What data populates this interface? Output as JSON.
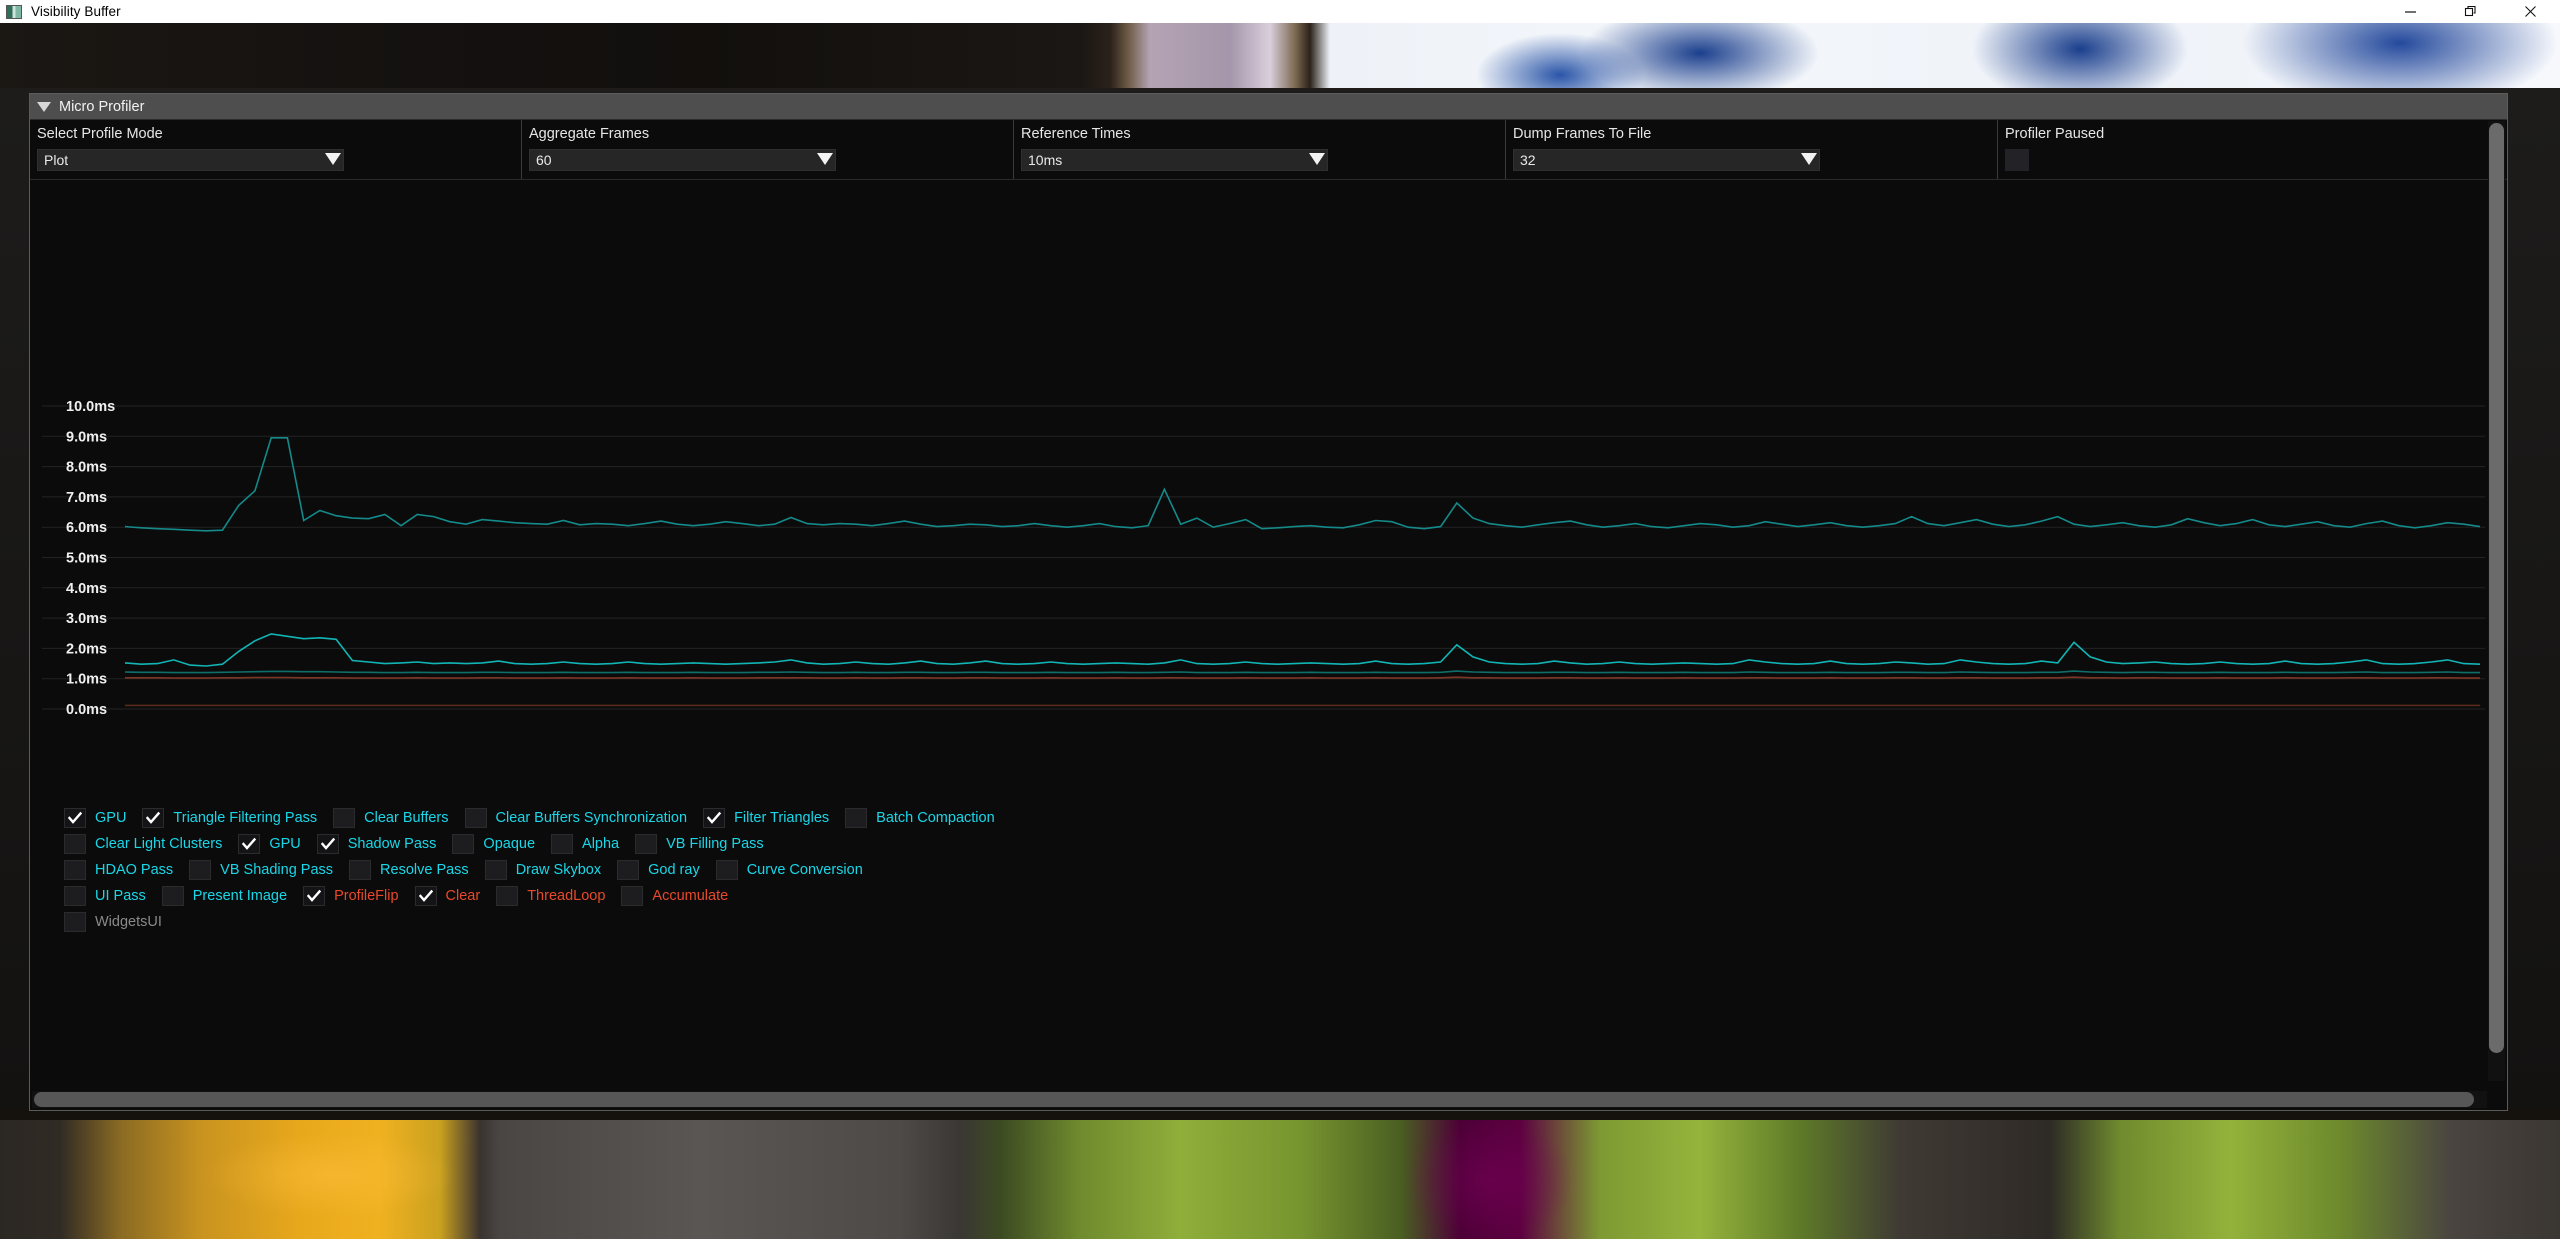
{
  "window": {
    "title": "Visibility Buffer",
    "icon": "app-icon",
    "minimize_label": "—",
    "restore_label": "❐",
    "close_label": "✕"
  },
  "panel": {
    "title": "Micro Profiler",
    "collapse_icon": "triangle-down-icon"
  },
  "controls": [
    {
      "label": "Select Profile Mode",
      "value": "Plot"
    },
    {
      "label": "Aggregate Frames",
      "value": "60"
    },
    {
      "label": "Reference Times",
      "value": "10ms"
    },
    {
      "label": "Dump Frames To File",
      "value": "32"
    }
  ],
  "pause": {
    "label": "Profiler Paused",
    "checked": false
  },
  "chart_data": {
    "type": "line",
    "title": "",
    "xlabel": "",
    "ylabel": "",
    "ylim": [
      0,
      10.4
    ],
    "yticks": [
      10.0,
      9.0,
      8.0,
      7.0,
      6.0,
      5.0,
      4.0,
      3.0,
      2.0,
      1.0,
      0.0
    ],
    "ytick_labels": [
      "10.0ms",
      "9.0ms",
      "8.0ms",
      "7.0ms",
      "6.0ms",
      "5.0ms",
      "4.0ms",
      "3.0ms",
      "2.0ms",
      "1.0ms",
      "0.0ms"
    ],
    "grid": true,
    "legend_position": "below",
    "series": [
      {
        "name": "GPU",
        "color": "#148a8a",
        "values": [
          6.02,
          5.98,
          5.95,
          5.93,
          5.9,
          5.88,
          5.9,
          6.72,
          7.2,
          8.95,
          8.95,
          6.22,
          6.55,
          6.38,
          6.3,
          6.28,
          6.42,
          6.05,
          6.42,
          6.35,
          6.18,
          6.1,
          6.25,
          6.2,
          6.15,
          6.12,
          6.1,
          6.22,
          6.08,
          6.12,
          6.1,
          6.05,
          6.12,
          6.2,
          6.1,
          6.05,
          6.1,
          6.18,
          6.12,
          6.05,
          6.1,
          6.32,
          6.12,
          6.08,
          6.12,
          6.1,
          6.05,
          6.12,
          6.2,
          6.1,
          6.02,
          6.05,
          6.1,
          6.08,
          6.02,
          6.05,
          6.12,
          6.05,
          6.0,
          6.05,
          6.12,
          6.02,
          5.98,
          6.05,
          7.25,
          6.1,
          6.3,
          6.0,
          6.12,
          6.25,
          5.95,
          5.98,
          6.02,
          6.05,
          6.0,
          5.98,
          6.08,
          6.22,
          6.18,
          6.0,
          5.95,
          6.02,
          6.8,
          6.3,
          6.12,
          6.05,
          6.0,
          6.08,
          6.15,
          6.2,
          6.08,
          6.0,
          6.05,
          6.12,
          6.02,
          5.98,
          6.05,
          6.12,
          6.08,
          6.0,
          6.05,
          6.18,
          6.1,
          6.02,
          6.08,
          6.15,
          6.05,
          6.0,
          6.05,
          6.12,
          6.35,
          6.12,
          6.05,
          6.15,
          6.25,
          6.1,
          6.02,
          6.08,
          6.2,
          6.35,
          6.1,
          6.02,
          6.08,
          6.15,
          6.05,
          6.0,
          6.08,
          6.28,
          6.15,
          6.05,
          6.12,
          6.25,
          6.08,
          6.02,
          6.1,
          6.18,
          6.05,
          6.0,
          6.12,
          6.2,
          6.05,
          5.98,
          6.05,
          6.15,
          6.1,
          6.02
        ]
      },
      {
        "name": "Triangle Filtering Pass",
        "color": "#12b5b5",
        "values": [
          1.52,
          1.48,
          1.5,
          1.62,
          1.45,
          1.42,
          1.48,
          1.9,
          2.25,
          2.48,
          2.4,
          2.32,
          2.35,
          2.3,
          1.6,
          1.55,
          1.5,
          1.52,
          1.55,
          1.5,
          1.52,
          1.5,
          1.52,
          1.58,
          1.5,
          1.48,
          1.5,
          1.55,
          1.5,
          1.48,
          1.5,
          1.55,
          1.5,
          1.48,
          1.5,
          1.52,
          1.5,
          1.48,
          1.5,
          1.52,
          1.55,
          1.62,
          1.52,
          1.48,
          1.5,
          1.55,
          1.5,
          1.48,
          1.52,
          1.58,
          1.5,
          1.48,
          1.52,
          1.58,
          1.5,
          1.48,
          1.5,
          1.55,
          1.5,
          1.48,
          1.5,
          1.52,
          1.5,
          1.48,
          1.52,
          1.62,
          1.5,
          1.48,
          1.5,
          1.55,
          1.5,
          1.48,
          1.5,
          1.52,
          1.5,
          1.48,
          1.5,
          1.58,
          1.5,
          1.48,
          1.5,
          1.55,
          2.12,
          1.72,
          1.55,
          1.5,
          1.48,
          1.5,
          1.58,
          1.52,
          1.48,
          1.5,
          1.55,
          1.5,
          1.48,
          1.5,
          1.52,
          1.5,
          1.48,
          1.5,
          1.62,
          1.55,
          1.5,
          1.48,
          1.5,
          1.58,
          1.5,
          1.48,
          1.5,
          1.55,
          1.52,
          1.48,
          1.5,
          1.62,
          1.55,
          1.5,
          1.48,
          1.5,
          1.58,
          1.52,
          2.2,
          1.72,
          1.55,
          1.5,
          1.52,
          1.55,
          1.5,
          1.48,
          1.5,
          1.55,
          1.5,
          1.48,
          1.5,
          1.58,
          1.5,
          1.48,
          1.5,
          1.55,
          1.62,
          1.5,
          1.48,
          1.5,
          1.55,
          1.62,
          1.5,
          1.48
        ]
      },
      {
        "name": "Filter Triangles",
        "color": "#0e6f6a",
        "values": [
          1.22,
          1.21,
          1.21,
          1.2,
          1.2,
          1.2,
          1.21,
          1.22,
          1.23,
          1.24,
          1.24,
          1.23,
          1.23,
          1.22,
          1.21,
          1.21,
          1.2,
          1.2,
          1.21,
          1.2,
          1.2,
          1.2,
          1.21,
          1.21,
          1.2,
          1.2,
          1.2,
          1.21,
          1.2,
          1.2,
          1.2,
          1.21,
          1.2,
          1.2,
          1.2,
          1.21,
          1.2,
          1.2,
          1.2,
          1.21,
          1.21,
          1.22,
          1.21,
          1.2,
          1.2,
          1.21,
          1.2,
          1.2,
          1.21,
          1.21,
          1.2,
          1.2,
          1.21,
          1.21,
          1.2,
          1.2,
          1.2,
          1.21,
          1.2,
          1.2,
          1.2,
          1.21,
          1.2,
          1.2,
          1.21,
          1.22,
          1.2,
          1.2,
          1.2,
          1.21,
          1.2,
          1.2,
          1.2,
          1.21,
          1.2,
          1.2,
          1.2,
          1.21,
          1.2,
          1.2,
          1.2,
          1.21,
          1.25,
          1.22,
          1.21,
          1.2,
          1.2,
          1.2,
          1.21,
          1.21,
          1.2,
          1.2,
          1.21,
          1.2,
          1.2,
          1.2,
          1.21,
          1.2,
          1.2,
          1.2,
          1.22,
          1.21,
          1.2,
          1.2,
          1.2,
          1.21,
          1.2,
          1.2,
          1.2,
          1.21,
          1.21,
          1.2,
          1.2,
          1.22,
          1.21,
          1.2,
          1.2,
          1.2,
          1.21,
          1.21,
          1.25,
          1.22,
          1.21,
          1.2,
          1.21,
          1.21,
          1.2,
          1.2,
          1.2,
          1.21,
          1.2,
          1.2,
          1.2,
          1.21,
          1.2,
          1.2,
          1.2,
          1.21,
          1.22,
          1.2,
          1.2,
          1.2,
          1.21,
          1.22,
          1.2,
          1.2
        ]
      },
      {
        "name": "ProfileFlip",
        "color": "#7d3524",
        "values": [
          1.03,
          1.03,
          1.03,
          1.02,
          1.02,
          1.02,
          1.03,
          1.03,
          1.04,
          1.04,
          1.04,
          1.03,
          1.03,
          1.03,
          1.02,
          1.02,
          1.02,
          1.02,
          1.03,
          1.02,
          1.02,
          1.02,
          1.03,
          1.03,
          1.02,
          1.02,
          1.02,
          1.03,
          1.02,
          1.02,
          1.02,
          1.03,
          1.02,
          1.02,
          1.02,
          1.03,
          1.02,
          1.02,
          1.02,
          1.03,
          1.03,
          1.03,
          1.03,
          1.02,
          1.02,
          1.03,
          1.02,
          1.02,
          1.03,
          1.03,
          1.02,
          1.02,
          1.03,
          1.03,
          1.02,
          1.02,
          1.02,
          1.03,
          1.02,
          1.02,
          1.02,
          1.03,
          1.02,
          1.02,
          1.03,
          1.03,
          1.02,
          1.02,
          1.02,
          1.03,
          1.02,
          1.02,
          1.02,
          1.03,
          1.02,
          1.02,
          1.02,
          1.03,
          1.02,
          1.02,
          1.02,
          1.03,
          1.05,
          1.03,
          1.03,
          1.02,
          1.02,
          1.02,
          1.03,
          1.03,
          1.02,
          1.02,
          1.03,
          1.02,
          1.02,
          1.02,
          1.03,
          1.02,
          1.02,
          1.02,
          1.03,
          1.03,
          1.02,
          1.02,
          1.02,
          1.03,
          1.02,
          1.02,
          1.02,
          1.03,
          1.03,
          1.02,
          1.02,
          1.03,
          1.03,
          1.02,
          1.02,
          1.02,
          1.03,
          1.03,
          1.05,
          1.03,
          1.03,
          1.02,
          1.03,
          1.03,
          1.02,
          1.02,
          1.02,
          1.03,
          1.02,
          1.02,
          1.02,
          1.03,
          1.02,
          1.02,
          1.02,
          1.03,
          1.03,
          1.02,
          1.02,
          1.02,
          1.03,
          1.03,
          1.02,
          1.02
        ]
      },
      {
        "name": "Clear",
        "color": "#5a2a1d",
        "values": [
          0.12,
          0.12,
          0.12,
          0.12,
          0.12,
          0.12,
          0.12,
          0.12,
          0.12,
          0.12,
          0.12,
          0.12,
          0.12,
          0.12,
          0.12,
          0.12,
          0.12,
          0.12,
          0.12,
          0.12,
          0.12,
          0.12,
          0.12,
          0.12,
          0.12,
          0.12,
          0.12,
          0.12,
          0.12,
          0.12,
          0.12,
          0.12,
          0.12,
          0.12,
          0.12,
          0.12,
          0.12,
          0.12,
          0.12,
          0.12,
          0.12,
          0.12,
          0.12,
          0.12,
          0.12,
          0.12,
          0.12,
          0.12,
          0.12,
          0.12,
          0.12,
          0.12,
          0.12,
          0.12,
          0.12,
          0.12,
          0.12,
          0.12,
          0.12,
          0.12,
          0.12,
          0.12,
          0.12,
          0.12,
          0.12,
          0.12,
          0.12,
          0.12,
          0.12,
          0.12,
          0.12,
          0.12,
          0.12,
          0.12,
          0.12,
          0.12,
          0.12,
          0.12,
          0.12,
          0.12,
          0.12,
          0.12,
          0.12,
          0.12,
          0.12,
          0.12,
          0.12,
          0.12,
          0.12,
          0.12,
          0.12,
          0.12,
          0.12,
          0.12,
          0.12,
          0.12,
          0.12,
          0.12,
          0.12,
          0.12,
          0.12,
          0.12,
          0.12,
          0.12,
          0.12,
          0.12,
          0.12,
          0.12,
          0.12,
          0.12,
          0.12,
          0.12,
          0.12,
          0.12,
          0.12,
          0.12,
          0.12,
          0.12,
          0.12,
          0.12,
          0.12,
          0.12,
          0.12,
          0.12,
          0.12,
          0.12,
          0.12,
          0.12,
          0.12,
          0.12,
          0.12,
          0.12,
          0.12,
          0.12,
          0.12,
          0.12,
          0.12,
          0.12,
          0.12,
          0.12,
          0.12,
          0.12,
          0.12,
          0.12,
          0.12,
          0.12
        ]
      }
    ]
  },
  "legend": {
    "rows": [
      [
        {
          "label": "GPU",
          "checked": true,
          "color": "cyan"
        },
        {
          "label": "Triangle Filtering Pass",
          "checked": true,
          "color": "cyan"
        },
        {
          "label": "Clear Buffers",
          "checked": false,
          "color": "cyan"
        },
        {
          "label": "Clear Buffers Synchronization",
          "checked": false,
          "color": "cyan"
        },
        {
          "label": "Filter Triangles",
          "checked": true,
          "color": "cyan"
        },
        {
          "label": "Batch Compaction",
          "checked": false,
          "color": "cyan"
        }
      ],
      [
        {
          "label": "Clear Light Clusters",
          "checked": false,
          "color": "cyan"
        },
        {
          "label": "GPU",
          "checked": true,
          "color": "cyan"
        },
        {
          "label": "Shadow Pass",
          "checked": true,
          "color": "cyan"
        },
        {
          "label": "Opaque",
          "checked": false,
          "color": "cyan"
        },
        {
          "label": "Alpha",
          "checked": false,
          "color": "cyan"
        },
        {
          "label": "VB Filling Pass",
          "checked": false,
          "color": "cyan"
        }
      ],
      [
        {
          "label": "HDAO Pass",
          "checked": false,
          "color": "cyan"
        },
        {
          "label": "VB Shading Pass",
          "checked": false,
          "color": "cyan"
        },
        {
          "label": "Resolve Pass",
          "checked": false,
          "color": "cyan"
        },
        {
          "label": "Draw Skybox",
          "checked": false,
          "color": "cyan"
        },
        {
          "label": "God ray",
          "checked": false,
          "color": "cyan"
        },
        {
          "label": "Curve Conversion",
          "checked": false,
          "color": "cyan"
        }
      ],
      [
        {
          "label": "UI Pass",
          "checked": false,
          "color": "cyan"
        },
        {
          "label": "Present Image",
          "checked": false,
          "color": "cyan"
        },
        {
          "label": "ProfileFlip",
          "checked": true,
          "color": "red"
        },
        {
          "label": "Clear",
          "checked": true,
          "color": "red"
        },
        {
          "label": "ThreadLoop",
          "checked": false,
          "color": "red"
        },
        {
          "label": "Accumulate",
          "checked": false,
          "color": "red"
        }
      ],
      [
        {
          "label": "WidgetsUI",
          "checked": false,
          "color": "gray"
        }
      ]
    ]
  },
  "scrollbars": {
    "vertical": "vertical-scrollbar",
    "horizontal": "horizontal-scrollbar"
  }
}
